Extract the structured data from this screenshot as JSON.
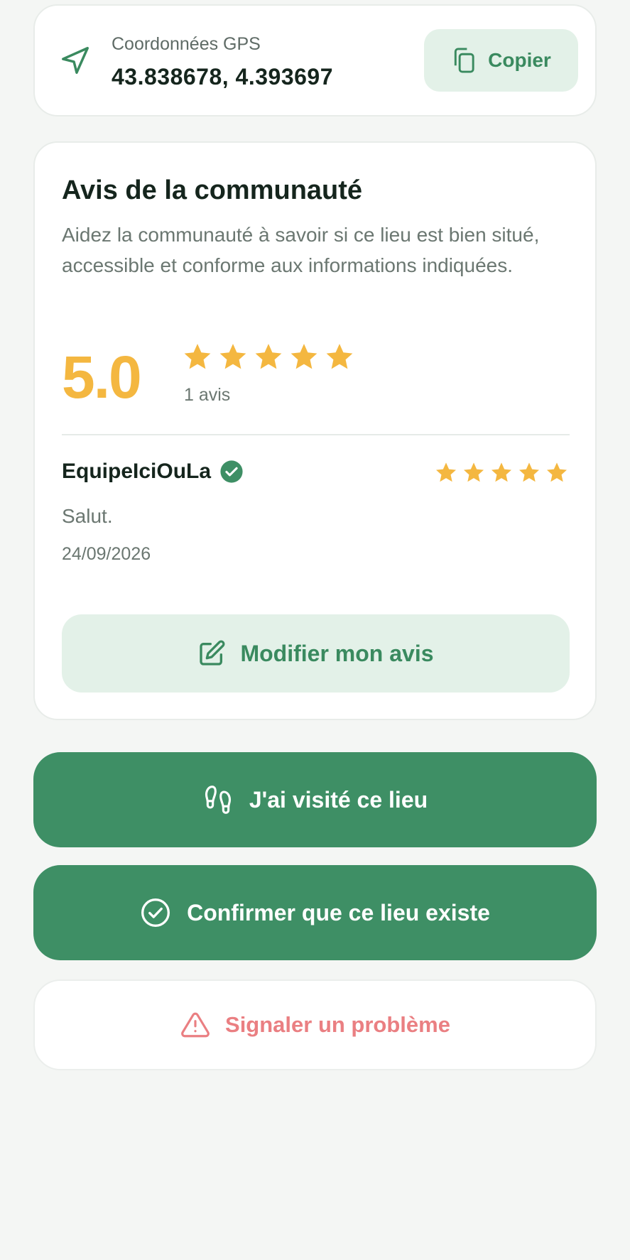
{
  "gps": {
    "label": "Coordonnées GPS",
    "value": "43.838678, 4.393697",
    "copy_label": "Copier",
    "icon": "navigation-arrow-icon",
    "copy_icon": "copy-icon"
  },
  "reviews": {
    "title": "Avis de la communauté",
    "subtitle": "Aidez la communauté à savoir si ce lieu est bien situé, accessible et conforme aux informations indiquées.",
    "score": "5.0",
    "stars": 5,
    "count_label": "1 avis",
    "items": [
      {
        "author": "EquipeIciOuLa",
        "verified": true,
        "rating": 5,
        "comment": "Salut.",
        "date": "24/09/2026"
      }
    ],
    "edit_label": "Modifier mon avis"
  },
  "actions": {
    "visited_label": "J'ai visité ce lieu",
    "confirm_label": "Confirmer que ce lieu existe",
    "report_label": "Signaler un problème"
  },
  "colors": {
    "accent_green": "#3e8f65",
    "light_green": "#e3f1e8",
    "star_yellow": "#f4b740",
    "report_red": "#ea7f82"
  }
}
